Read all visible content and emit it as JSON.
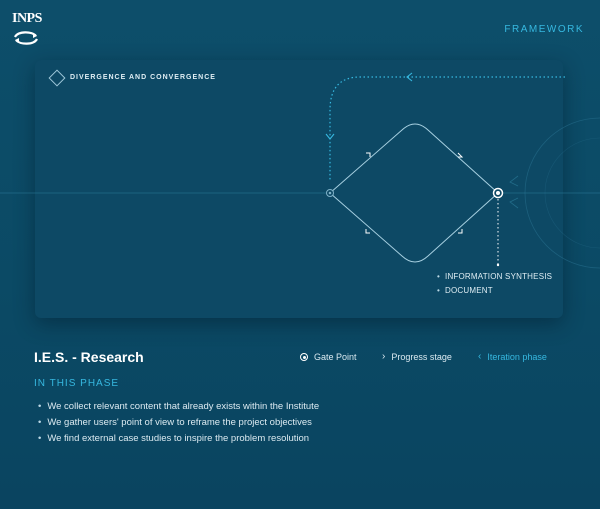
{
  "header": {
    "logo_text": "INPS",
    "nav_link": "FRAMEWORK"
  },
  "diagram": {
    "title": "DIVERGENCE AND CONVERGENCE",
    "outputs": [
      "INFORMATION SYNTHESIS",
      "DOCUMENT"
    ]
  },
  "phase": {
    "title": "I.E.S. - Research",
    "section_label": "IN THIS PHASE",
    "activities": [
      "We collect relevant content that already exists within the Institute",
      "We gather users' point of view to reframe the project objectives",
      "We find external case studies to inspire the problem resolution"
    ]
  },
  "legend": {
    "gate_point": "Gate Point",
    "progress_stage": "Progress stage",
    "iteration_phase": "Iteration phase"
  },
  "colors": {
    "accent": "#36b8e0",
    "background": "#0d4e6a",
    "card": "#0d4965"
  }
}
